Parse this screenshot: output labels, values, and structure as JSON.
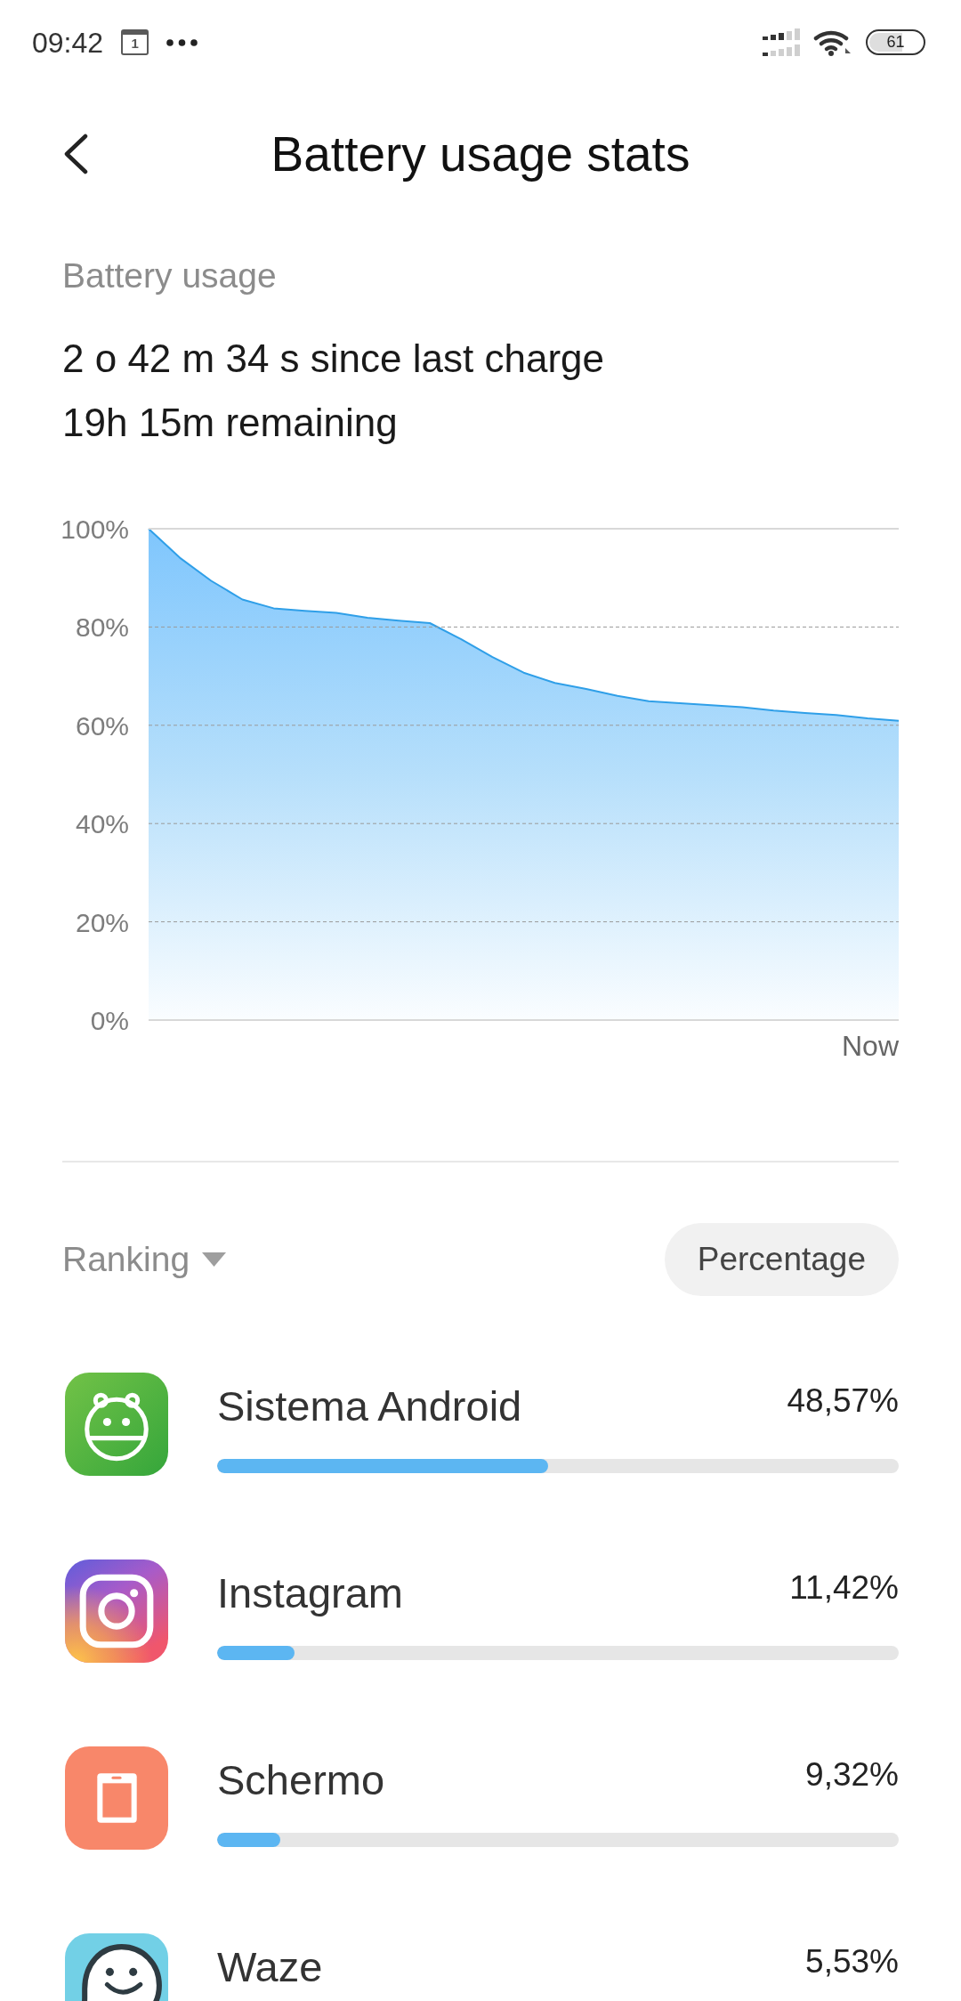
{
  "status_bar": {
    "time": "09:42",
    "calendar_day": "1",
    "battery": "61"
  },
  "header": {
    "title": "Battery usage stats"
  },
  "summary": {
    "label": "Battery usage",
    "since_charge": "2 o 42 m 34 s since last charge",
    "remaining": "19h 15m remaining"
  },
  "chart": {
    "chart_data": {
      "type": "area",
      "xlabel": "Now",
      "grid": true,
      "values": [
        100,
        94.1,
        89.4,
        85.6,
        83.8,
        83.3,
        82.9,
        81.9,
        81.3,
        80.8,
        77.5,
        73.9,
        70.7,
        68.6,
        67.4,
        66,
        64.9,
        64.5,
        64.1,
        63.7,
        63,
        62.5,
        62.1,
        61.4,
        60.9
      ],
      "ylim": [
        0,
        100
      ],
      "yticks": [
        {
          "value": 0,
          "label": "0%"
        },
        {
          "value": 20,
          "label": "20%"
        },
        {
          "value": 40,
          "label": "40%"
        },
        {
          "value": 60,
          "label": "60%"
        },
        {
          "value": 80,
          "label": "80%"
        },
        {
          "value": 100,
          "label": "100%"
        }
      ]
    }
  },
  "ranking": {
    "sort_label": "Ranking",
    "mode_button": "Percentage"
  },
  "apps": [
    {
      "name": "Sistema Android",
      "percentage": "48,57%",
      "level": 0.4857
    },
    {
      "name": "Instagram",
      "percentage": "11,42%",
      "level": 0.1142
    },
    {
      "name": "Schermo",
      "percentage": "9,32%",
      "level": 0.0932
    },
    {
      "name": "Waze",
      "percentage": "5,53%"
    }
  ]
}
